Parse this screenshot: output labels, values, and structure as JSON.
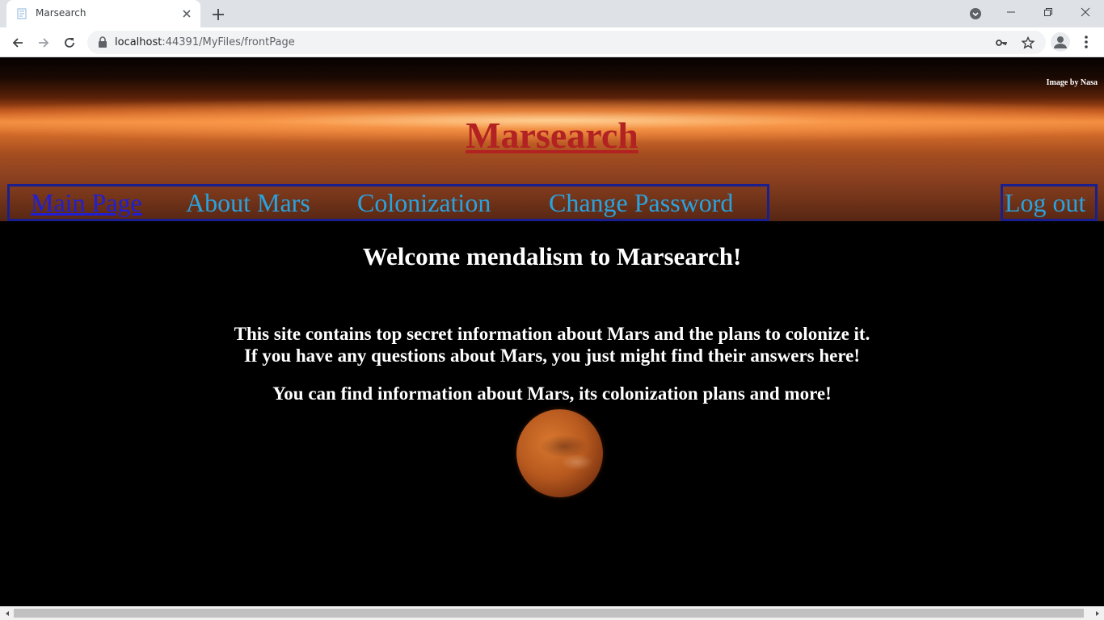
{
  "browser": {
    "tab_title": "Marsearch",
    "url_host": "localhost",
    "url_path": ":44391/MyFiles/frontPage"
  },
  "page": {
    "image_credit": "Image by Nasa",
    "site_title": "Marsearch",
    "nav": {
      "main_page": "Main Page",
      "about_mars": "About Mars",
      "colonization": "Colonization",
      "change_password": "Change Password",
      "log_out": "Log out"
    },
    "welcome": "Welcome mendalism to Marsearch!",
    "intro_line1": "This site contains top secret information about Mars and the plans to colonize it.",
    "intro_line2": "If you have any questions about Mars, you just might find their answers here!",
    "intro_line3": "You can find information about Mars, its colonization plans and more!"
  },
  "colors": {
    "title": "#b22222",
    "nav_link": "#29a3e0",
    "nav_active": "#1f1fd6",
    "nav_border": "#1a1f8f",
    "background": "#000000"
  }
}
